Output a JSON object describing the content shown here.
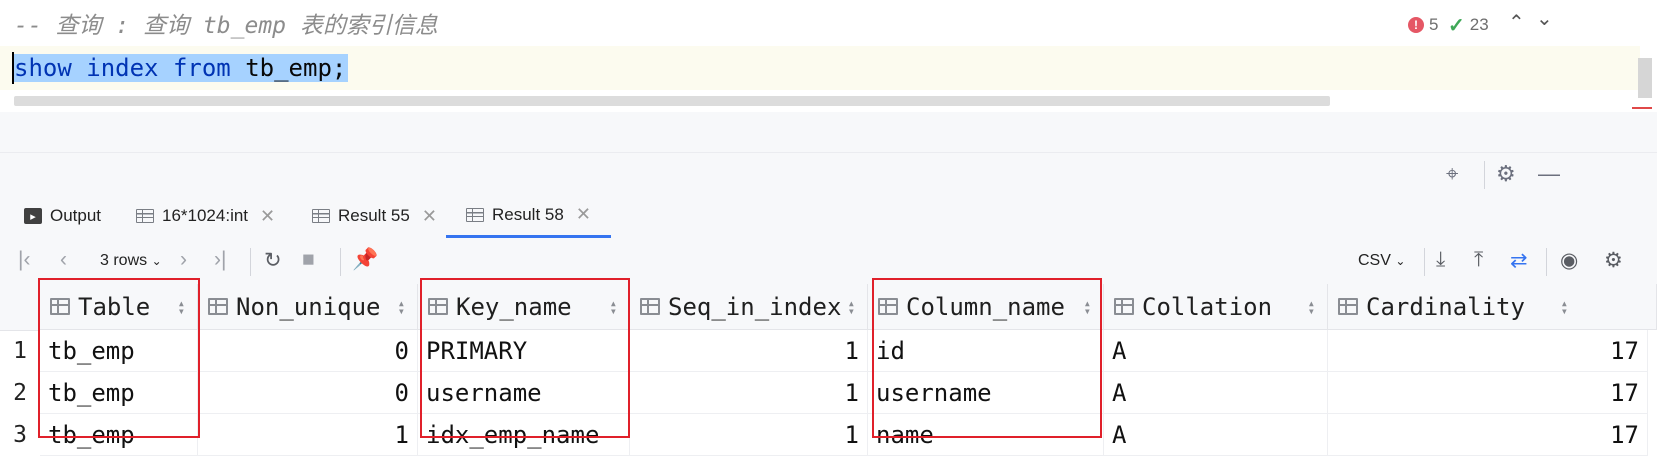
{
  "editor": {
    "comment": "-- 查询 : 查询 tb_emp 表的索引信息",
    "code": {
      "kw1": "show",
      "kw2": "index",
      "kw3": "from",
      "table": "tb_emp",
      "end": ";"
    },
    "errors": "5",
    "warnings": "23"
  },
  "tabs": [
    {
      "label": "Output"
    },
    {
      "label": "16*1024:int"
    },
    {
      "label": "Result 55"
    },
    {
      "label": "Result 58"
    }
  ],
  "toolbar": {
    "rows_label": "3 rows",
    "export_format": "CSV"
  },
  "table": {
    "columns": [
      "Table",
      "Non_unique",
      "Key_name",
      "Seq_in_index",
      "Column_name",
      "Collation",
      "Cardinality"
    ],
    "rows": [
      {
        "n": "1",
        "Table": "tb_emp",
        "Non_unique": "0",
        "Key_name": "PRIMARY",
        "Seq_in_index": "1",
        "Column_name": "id",
        "Collation": "A",
        "Cardinality": "17"
      },
      {
        "n": "2",
        "Table": "tb_emp",
        "Non_unique": "0",
        "Key_name": "username",
        "Seq_in_index": "1",
        "Column_name": "username",
        "Collation": "A",
        "Cardinality": "17"
      },
      {
        "n": "3",
        "Table": "tb_emp",
        "Non_unique": "1",
        "Key_name": "idx_emp_name",
        "Seq_in_index": "1",
        "Column_name": "name",
        "Collation": "A",
        "Cardinality": "17"
      }
    ]
  },
  "colors": {
    "highlight": "#e0202a",
    "accent": "#3574f0",
    "keyword": "#0033b3",
    "selection": "#a6d2ff"
  }
}
